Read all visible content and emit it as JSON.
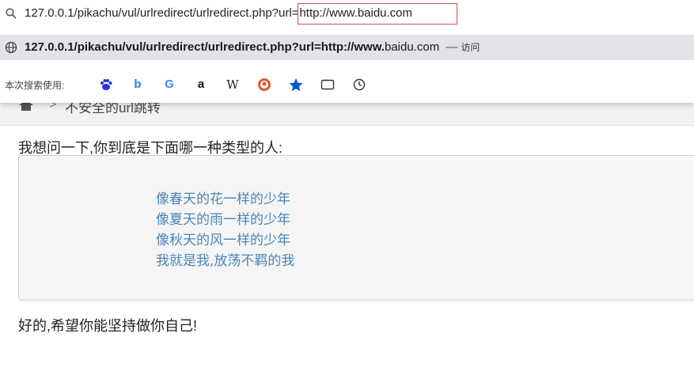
{
  "browser": {
    "url_prefix": "127.0.0.1/pikachu/vul/urlredirect/urlredirect.php?url=",
    "url_highlight": "http://www.baidu.com",
    "suggestion": {
      "bold": "127.0.0.1/pikachu/vul/urlredirect/urlredirect.php?url=http://www.",
      "rest": "baidu.com",
      "dash": "—",
      "action": "访问"
    },
    "search_engines_label": "本次搜索使用:",
    "search_engines": [
      "baidu-icon",
      "bing-icon",
      "google-icon",
      "amazon-icon",
      "wikipedia-icon",
      "duckduckgo-icon",
      "bookmarks-icon",
      "tabs-icon",
      "history-icon"
    ]
  },
  "page": {
    "breadcrumb_separator": ">",
    "breadcrumb": "不安全的url跳转",
    "question": "我想问一下,你到底是下面哪一种类型的人:",
    "answers": [
      "像春天的花一样的少年",
      "像夏天的雨一样的少年",
      "像秋天的风一样的少年",
      "我就是我,放荡不羁的我"
    ],
    "closing": "好的,希望你能坚持做你自己!"
  },
  "colors": {
    "link": "#4a86b8",
    "highlight_border": "#d64a4a",
    "suggestion_bg": "#e2e2e8"
  }
}
